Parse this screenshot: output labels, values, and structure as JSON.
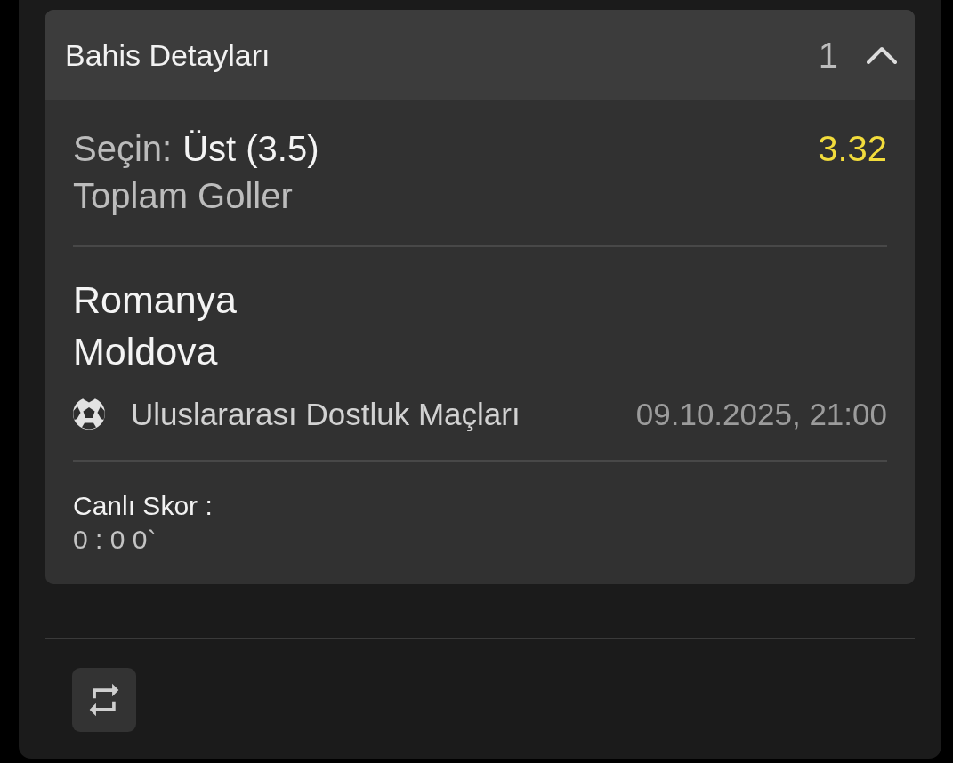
{
  "bet_details": {
    "title": "Bahis Detayları",
    "count": "1",
    "expanded": true
  },
  "selection": {
    "label": "Seçin:",
    "pick": "Üst (3.5)",
    "market": "Toplam Goller",
    "odds": "3.32"
  },
  "event": {
    "teams": [
      "Romanya",
      "Moldova"
    ],
    "league": "Uluslararası Dostluk Maçları",
    "datetime": "09.10.2025, 21:00"
  },
  "live_score": {
    "label": "Canlı Skor :",
    "score": "0 : 0 0`"
  }
}
